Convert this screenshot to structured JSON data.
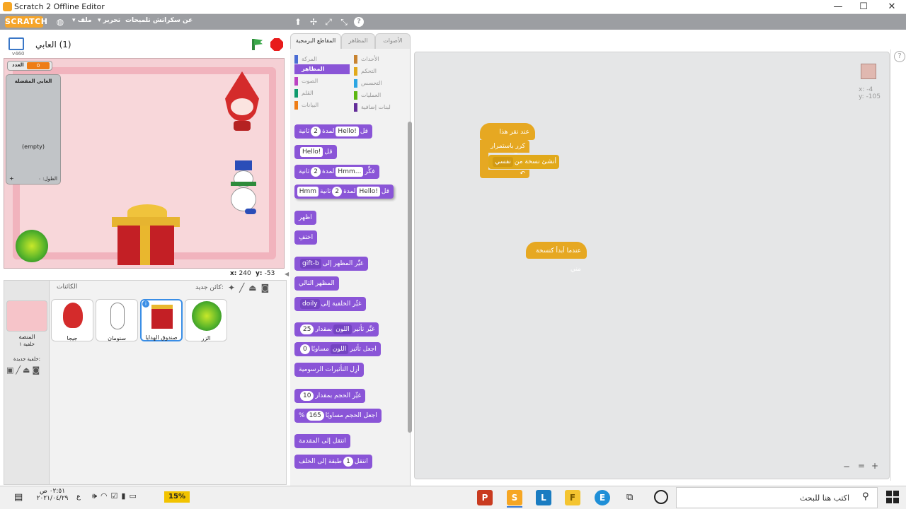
{
  "window": {
    "title": "Scratch 2 Offline Editor",
    "minimize": "—",
    "maximize": "☐",
    "close": "✕"
  },
  "menubar": {
    "logo": "SCRATCH",
    "items": [
      "عن سكراتش",
      "تلميحات",
      "تحرير",
      "ملف"
    ]
  },
  "stage": {
    "project_name": "(1) العابي",
    "version": "v460",
    "variable": {
      "name": "العدد",
      "value": "0"
    },
    "list": {
      "title": "العابي المفضلة",
      "empty": "(empty)",
      "length_label": "الطول: ٠",
      "add": "+"
    },
    "coords": {
      "x_label": "x:",
      "x": "240",
      "y_label": "y:",
      "y": "-53"
    }
  },
  "sprites_pane": {
    "header": "الكائنات",
    "new_sprite": "كائن جديد:",
    "stage_label": "المنصة",
    "stage_sub": "خلفية ١",
    "new_backdrop": "خلفية جديدة:",
    "sprites": [
      {
        "name": "جيجا"
      },
      {
        "name": "سنومان"
      },
      {
        "name": "صندوق الهدايا"
      },
      {
        "name": "الزر"
      }
    ]
  },
  "tabs": [
    "المقاطع البرمجية",
    "المظاهر",
    "الأصوات"
  ],
  "categories": {
    "left": [
      "المركة",
      "المظاهر",
      "الصوت",
      "القلم",
      "البيانات"
    ],
    "right": [
      "الأحداث",
      "التحكم",
      "التحسس",
      "العمليات",
      "لبنات إضافية"
    ],
    "colors": {
      "motion": "#4a6cd4",
      "looks": "#8a55d7",
      "sound": "#bb42c3",
      "pen": "#0e9a6c",
      "data": "#ee7d16",
      "events": "#c88330",
      "control": "#e1a91a",
      "sensing": "#2ca5e2",
      "operators": "#5cb712",
      "more": "#632d99"
    }
  },
  "blocks": {
    "say_for": {
      "a": "قل",
      "v1": "Hello!",
      "b": "لمدة",
      "v2": "2",
      "c": "ثانية"
    },
    "say": {
      "a": "قل",
      "v1": "Hello!"
    },
    "think_for": {
      "a": "فكِّر",
      "v1": "Hmm...",
      "b": "لمدة",
      "v2": "2",
      "c": "ثانية"
    },
    "dragged": {
      "a": "قل",
      "v1": "Hello!",
      "b": "لمدة",
      "v2": "2",
      "c": "ثانية",
      "v3": "Hmm"
    },
    "show": "اظهر",
    "hide": "اختفِ",
    "switch_costume": {
      "a": "غيِّر المظهر إلى",
      "v": "gift-b"
    },
    "next_costume": "المظهر التالي",
    "switch_backdrop": {
      "a": "غيِّر الخلفية إلى",
      "v": "doily"
    },
    "change_effect": {
      "a": "غيِّر تأثير",
      "v1": "اللون",
      "b": "بمقدار",
      "v2": "25"
    },
    "set_effect": {
      "a": "اجعل تأثير",
      "v1": "اللون",
      "b": "مساويًا",
      "v2": "0"
    },
    "clear_effects": "أزِل التأثيرات الرسومية",
    "change_size": {
      "a": "غيِّر الحجم بمقدار",
      "v": "10"
    },
    "set_size": {
      "a": "اجعل الحجم مساويًا",
      "v": "165",
      "b": "%"
    },
    "front": "انتقل إلى المقدمة",
    "back": {
      "a": "انتقل",
      "v": "1",
      "b": "طبقة إلى الخلف"
    }
  },
  "script": {
    "hat": "عند نقر هذا الكائن",
    "forever": "كرر باستمرار",
    "clone": {
      "a": "أنشئ نسخة من",
      "v": "نفسي"
    },
    "hat2": "عندما أبدأ كنسخة مني",
    "sprite_x": "x: -4",
    "sprite_y": "y: -105"
  },
  "zoom": {
    "out": "−",
    "reset": "=",
    "in": "+"
  },
  "taskbar": {
    "search": "اكتب هنا للبحث",
    "time": "٠٢:٥١ ص",
    "date": "٢٠٢١/٠٤/٢٩",
    "battery": "15%",
    "lang": "ع",
    "apps": [
      "P",
      "S",
      "L",
      "F",
      "E",
      "T",
      "O"
    ]
  }
}
